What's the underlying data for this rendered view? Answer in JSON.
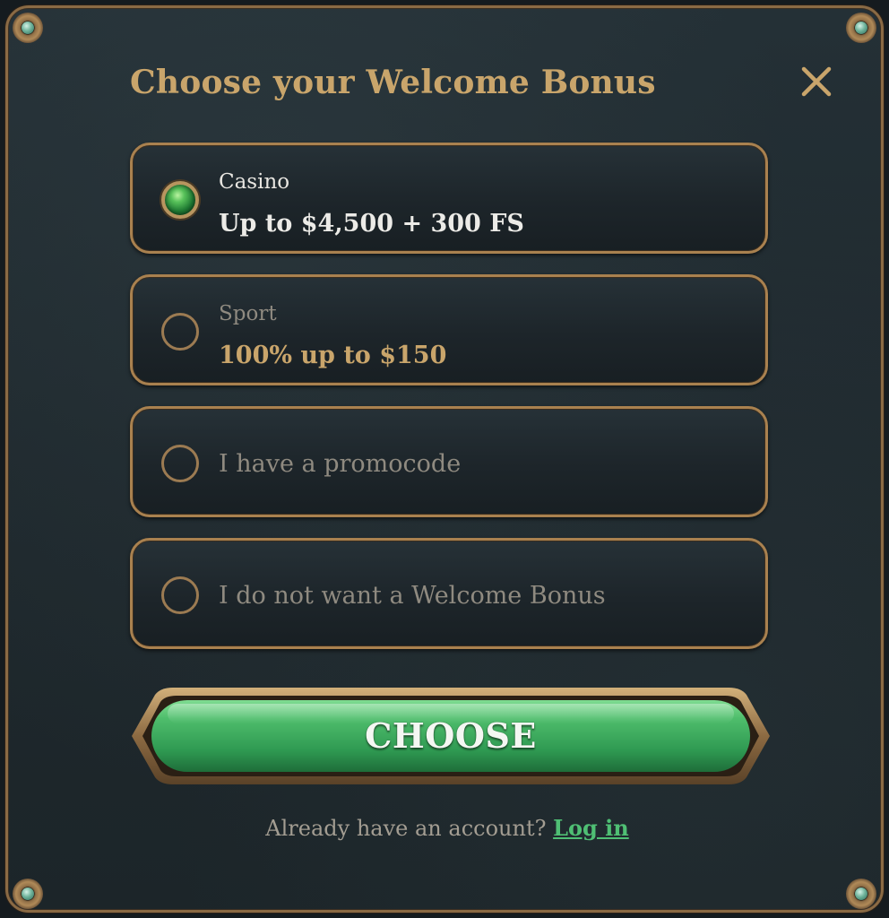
{
  "modal": {
    "title": "Choose your Welcome Bonus"
  },
  "options": [
    {
      "category": "Casino",
      "value": "Up to $4,500 + 300 FS",
      "selected": true
    },
    {
      "category": "Sport",
      "value": "100% up to $150",
      "selected": false
    },
    {
      "label": "I have a promocode",
      "selected": false
    },
    {
      "label": "I do not want a Welcome Bonus",
      "selected": false
    }
  ],
  "choose_button": {
    "label": "CHOOSE"
  },
  "footer": {
    "prompt": "Already have an account?",
    "login_link": "Log in"
  },
  "icons": {
    "close": "close-icon",
    "selected_radio": "emerald-gem-radio-icon"
  },
  "colors": {
    "gold_accent": "#c9a56b",
    "border_bronze": "#a9814f",
    "button_green": "#3fae63",
    "link_green": "#4fbf74",
    "background": "#1f292e"
  }
}
